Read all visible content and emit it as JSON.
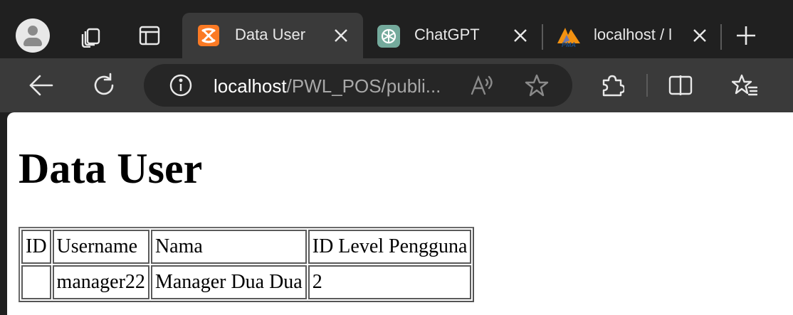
{
  "browser": {
    "tabs": [
      {
        "title": "Data User",
        "favicon": "xampp-icon",
        "active": true
      },
      {
        "title": "ChatGPT",
        "favicon": "chatgpt-icon",
        "active": false
      },
      {
        "title": "localhost / l",
        "favicon": "phpmyadmin-icon",
        "active": false
      }
    ],
    "address": {
      "host": "localhost",
      "path": "/PWL_POS/publi..."
    },
    "colors": {
      "frame": "#202020",
      "toolbar": "#3a3a3a",
      "omnibox": "#262626",
      "xampp": "#fb7a24"
    }
  },
  "page": {
    "heading": "Data User",
    "table": {
      "headers": [
        "ID",
        "Username",
        "Nama",
        "ID Level Pengguna"
      ],
      "rows": [
        [
          "",
          "manager22",
          "Manager Dua Dua",
          "2"
        ]
      ]
    }
  }
}
